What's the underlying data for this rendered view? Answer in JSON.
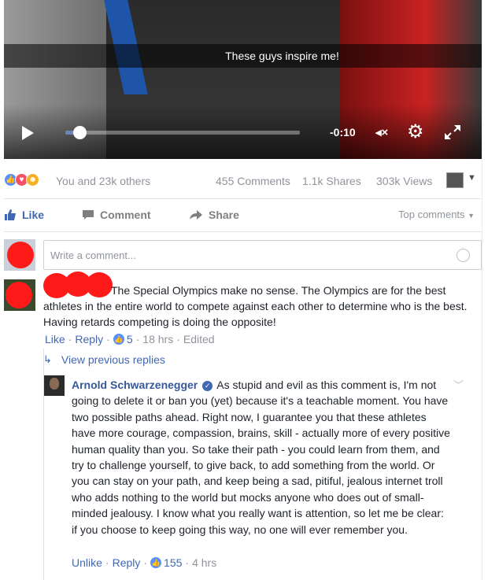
{
  "video": {
    "caption": "These guys inspire me!",
    "time_remaining": "-0:10",
    "progress_fraction": 0.06,
    "icons": [
      "play-icon",
      "mute-icon",
      "gear-icon",
      "fullscreen-icon"
    ],
    "mute_label": "◂×"
  },
  "stats": {
    "reactions": [
      "like",
      "love",
      "haha"
    ],
    "likers": "You and 23k others",
    "comments": "455 Comments",
    "shares": "1.1k Shares",
    "views": "303k Views"
  },
  "actions": {
    "like": "Like",
    "comment": "Comment",
    "share": "Share",
    "sort": "Top comments"
  },
  "composer": {
    "placeholder": "Write a comment..."
  },
  "comment": {
    "text": "The Special Olympics make no sense. The Olympics are for the best athletes in the entire world to compete against each other to determine who is the best. Having retards competing is doing the opposite!",
    "like": "Like",
    "reply": "Reply",
    "likes": "5",
    "time": "18 hrs",
    "edited": "Edited"
  },
  "view_previous": "View previous replies",
  "reply": {
    "author": "Arnold Schwarzenegger",
    "text": "As stupid and evil as this comment is, I'm not going to delete it or ban you (yet) because it's a teachable moment. You have two possible paths ahead. Right now, I guarantee you that these athletes have more courage, compassion, brains, skill - actually more of every positive human quality than you. So take their path - you could learn from them, and try to challenge yourself, to give back, to add something from the world. Or you can stay on your path, and keep being a sad, pitiful, jealous internet troll who adds nothing to the world but mocks anyone who does out of small-minded jealousy. I know what you really want is attention, so let me be clear: if you choose to keep going this way, no one will ever remember you.",
    "unlike": "Unlike",
    "reply": "Reply",
    "likes": "155",
    "time": "4 hrs"
  },
  "colors": {
    "link": "#4267b2",
    "meta": "#90949c",
    "like_reaction": "#5890ff",
    "love_reaction": "#f25268",
    "haha_reaction": "#f7b125",
    "redaction": "#ff1a1a"
  }
}
